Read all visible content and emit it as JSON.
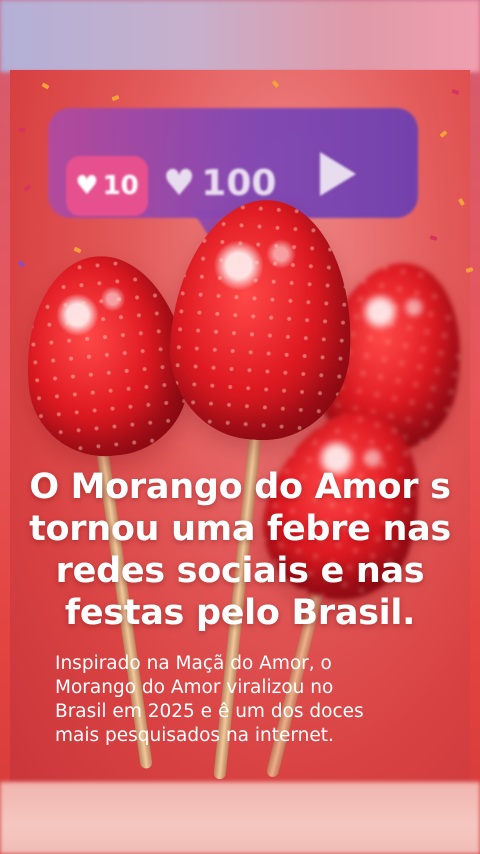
{
  "notification": {
    "like_chip_count": "10",
    "likes_count": "100",
    "icons": [
      "heart-icon",
      "heart-icon",
      "play-icon"
    ]
  },
  "headline": {
    "lines": [
      "O Morango do Amor s",
      "tornou uma febre nas",
      "redes sociais e nas",
      "festas pelo Brasil."
    ]
  },
  "body": {
    "lines": [
      "Inspirado na Maçã do Amor, o",
      "Morango do Amor viralizou no",
      "Brasil em 2025 e ê um dos doces",
      "mais pesquisados na internet."
    ]
  },
  "colors": {
    "background": "#e2443f",
    "notification_bubble": "#7c46b7",
    "like_chip": "#e6508f",
    "strawberry": "#e01a22",
    "text": "#ffffff"
  }
}
